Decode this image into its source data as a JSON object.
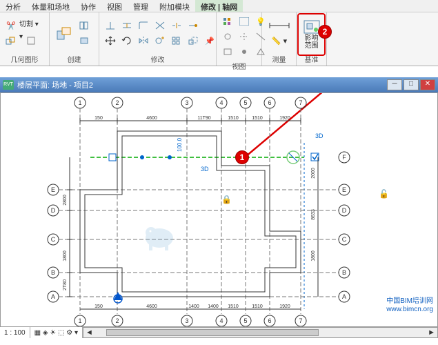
{
  "ribbon": {
    "tabs": [
      "分析",
      "体量和场地",
      "协作",
      "视图",
      "管理",
      "附加模块",
      "修改 | 轴网"
    ],
    "activeTab": "修改 | 轴网",
    "groups": {
      "geom": "几何图形",
      "create": "创建",
      "modify": "修改",
      "view": "视图",
      "measure": "测量",
      "basis": "基准",
      "basisBtn": "影响\n范围"
    }
  },
  "doc": {
    "title": "楼层平面: 场地 - 项目2",
    "zoom": "1 : 100"
  },
  "badge1": "1",
  "badge2": "2",
  "grid": {
    "cols": [
      "1",
      "2",
      "3",
      "4",
      "5",
      "6",
      "7"
    ],
    "rowsLeft": [
      "E",
      "D",
      "C",
      "B",
      "A"
    ],
    "rowsRight": [
      "F",
      "E",
      "D",
      "C",
      "B",
      "A"
    ],
    "dimsTop": [
      "150",
      "4600",
      "11T90",
      "1510",
      "1510",
      "1920"
    ],
    "dimsRight": [
      "2000",
      "8633",
      "1800"
    ],
    "dimsLeft": [
      "2800",
      "1800",
      "2T80"
    ],
    "dimsBottom": [
      "150",
      "4600",
      "1400",
      "1400",
      "1510",
      "1510",
      "1920"
    ],
    "label3D": "3D",
    "dim3D": "100.0"
  },
  "watermark": {
    "line1": "中国BIM培训网",
    "line2": "www.bimcn.org"
  }
}
